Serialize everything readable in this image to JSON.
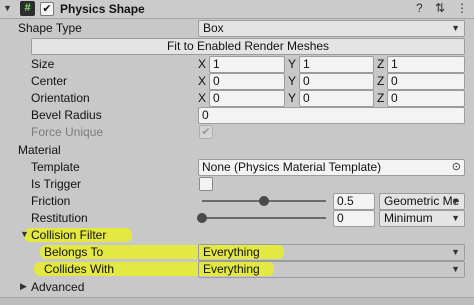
{
  "header": {
    "fold_glyph": "▼",
    "script_icon": "#",
    "enabled_check": "✔",
    "title": "Physics Shape",
    "help_glyph": "?",
    "preset_glyph": "⇅",
    "menu_glyph": "⋮"
  },
  "shape_type": {
    "label": "Shape Type",
    "value": "Box"
  },
  "fit_button": {
    "label": "Fit to Enabled Render Meshes"
  },
  "size": {
    "label": "Size",
    "x_axis": "X",
    "y_axis": "Y",
    "z_axis": "Z",
    "x": "1",
    "y": "1",
    "z": "1"
  },
  "center": {
    "label": "Center",
    "x_axis": "X",
    "y_axis": "Y",
    "z_axis": "Z",
    "x": "0",
    "y": "0",
    "z": "0"
  },
  "orientation": {
    "label": "Orientation",
    "x_axis": "X",
    "y_axis": "Y",
    "z_axis": "Z",
    "x": "0",
    "y": "0",
    "z": "0"
  },
  "bevel_radius": {
    "label": "Bevel Radius",
    "value": "0"
  },
  "force_unique": {
    "label": "Force Unique",
    "check_glyph": "✔"
  },
  "material": {
    "label": "Material",
    "template": {
      "label": "Template",
      "value": "None (Physics Material Template)",
      "picker_glyph": "⊙"
    },
    "is_trigger": {
      "label": "Is Trigger"
    },
    "friction": {
      "label": "Friction",
      "value": "0.5",
      "slider_fraction": 0.5,
      "combine": "Geometric Me"
    },
    "restitution": {
      "label": "Restitution",
      "value": "0",
      "slider_fraction": 0.0,
      "combine": "Minimum"
    }
  },
  "collision_filter": {
    "fold_glyph": "▼",
    "label": "Collision Filter",
    "belongs_to": {
      "label": "Belongs To",
      "value": "Everything"
    },
    "collides_with": {
      "label": "Collides With",
      "value": "Everything"
    }
  },
  "advanced": {
    "fold_glyph": "▶",
    "label": "Advanced"
  },
  "dropdown_glyph": "▼",
  "colors": {
    "highlight": "#e8ee2a",
    "panel": "#c8c8c8",
    "field": "#f3f3f3"
  }
}
